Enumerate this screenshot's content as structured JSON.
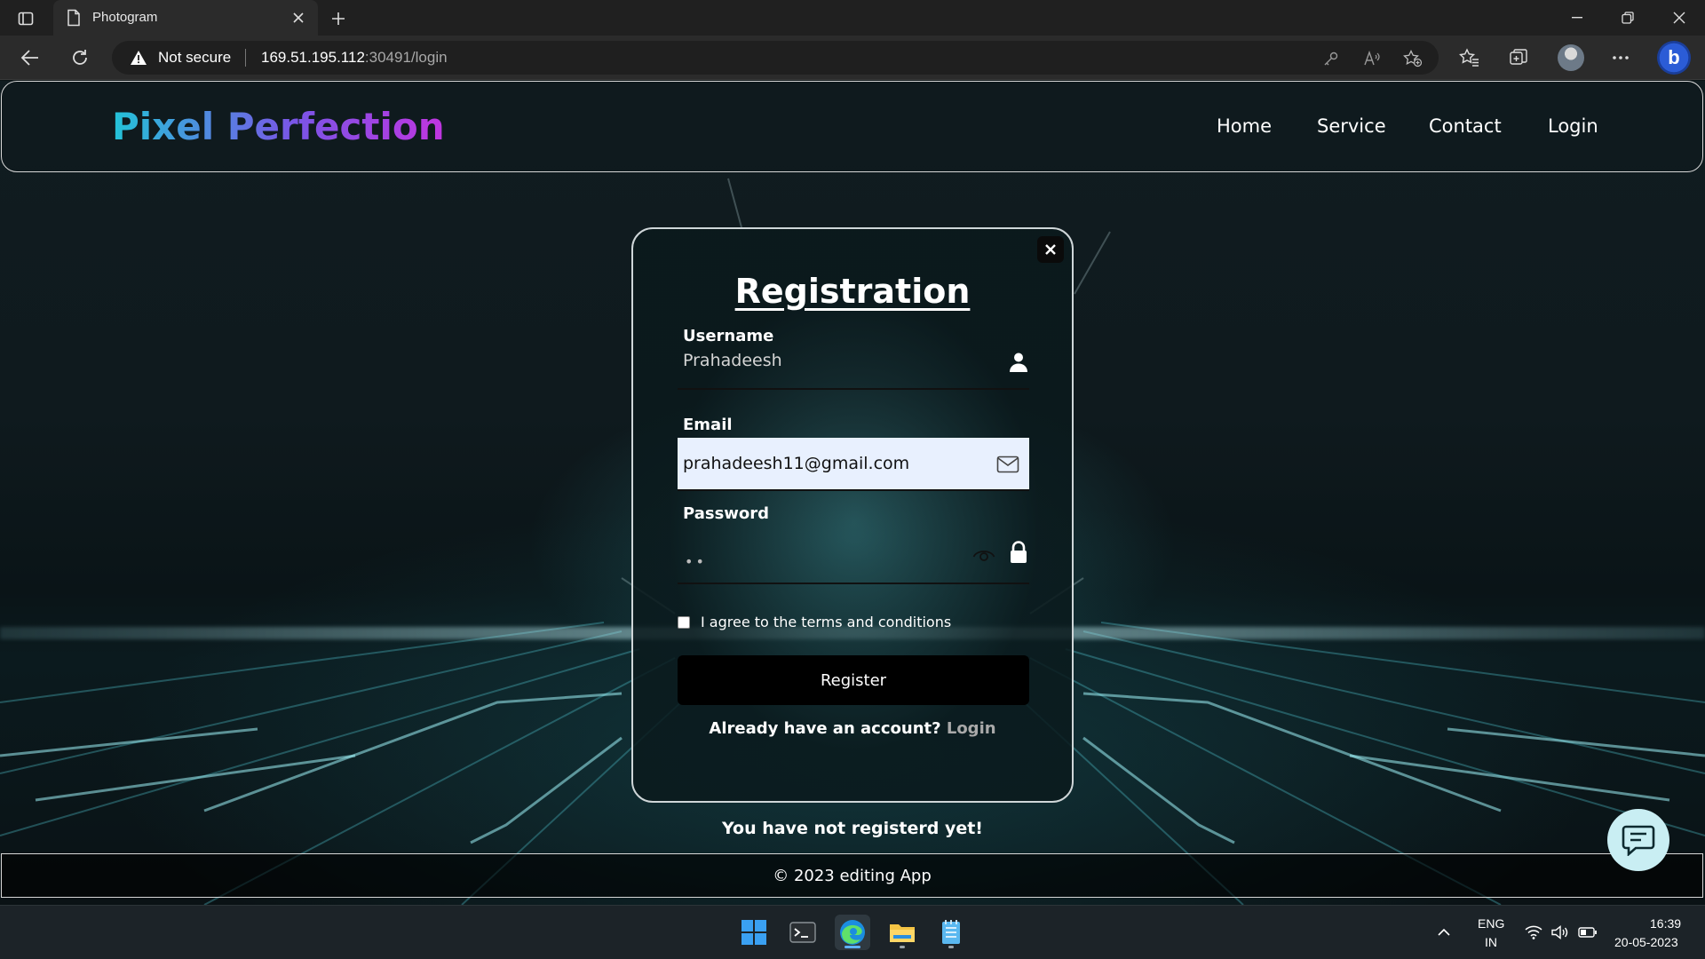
{
  "browser": {
    "tab_title": "Photogram",
    "security_label": "Not secure",
    "url_host": "169.51.195.112",
    "url_rest": ":30491/login"
  },
  "site": {
    "brand": "Pixel Perfection",
    "nav": [
      "Home",
      "Service",
      "Contact",
      "Login"
    ]
  },
  "modal": {
    "title": "Registration",
    "username_label": "Username",
    "username_value": "Prahadeesh",
    "email_label": "Email",
    "email_value": "prahadeesh11@gmail.com",
    "password_label": "Password",
    "password_mask": "••",
    "terms_text": "I agree to the terms and conditions",
    "register_label": "Register",
    "have_account_text": "Already have an account?",
    "login_link": "Login"
  },
  "page": {
    "status_message": "You have not registerd yet!",
    "footer": "© 2023 editing App"
  },
  "taskbar": {
    "lang_top": "ENG",
    "lang_bottom": "IN",
    "time": "16:39",
    "date": "20-05-2023"
  },
  "colors": {
    "brand_gradient": [
      "#23c3d8",
      "#7a55e6",
      "#c035e0"
    ],
    "autofill_bg": "#e8f0fe",
    "chat_fab": "#c9eef3"
  }
}
